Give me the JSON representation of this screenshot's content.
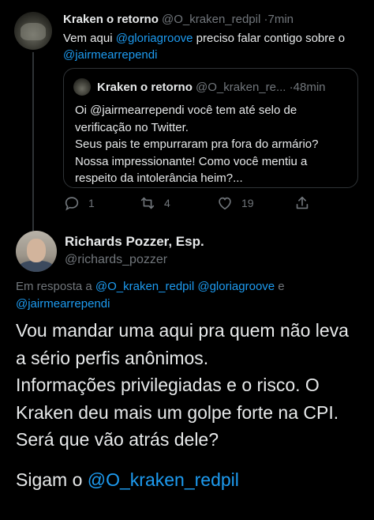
{
  "tweet1": {
    "author_name": "Kraken o retorno",
    "author_handle": "@O_kraken_redpil",
    "separator": "·",
    "time": "7min",
    "text_a": "Vem aqui ",
    "mention_a": "@gloriagroove",
    "text_b": " preciso falar contigo sobre o ",
    "mention_b": "@jairmearrependi",
    "quote": {
      "author_name": "Kraken o retorno",
      "author_handle": "@O_kraken_re...",
      "separator": "·",
      "time": "48min",
      "lines": [
        "Oi @jairmearrependi você tem até selo de",
        "verificação no Twitter.",
        "Seus pais te empurraram pra fora do armário?",
        "Nossa impressionante! Como você mentiu a",
        "respeito da intolerância heim?..."
      ]
    },
    "actions": {
      "replies": "1",
      "retweets": "4",
      "likes": "19"
    }
  },
  "tweet2": {
    "author_name": "Richards Pozzer, Esp.",
    "author_handle": "@richards_pozzer",
    "reply_prefix": "Em resposta a ",
    "reply_mention_1": "@O_kraken_redpil",
    "reply_mention_2": "@gloriagroove",
    "reply_conj": " e ",
    "reply_mention_3": "@jairmearrependi",
    "paragraph_1": "Vou mandar uma aqui pra quem não leva a sério perfis anônimos.",
    "paragraph_2": "Informações privilegiadas e o risco. O Kraken deu mais um golpe forte na CPI.",
    "paragraph_3": "Será que vão atrás dele?",
    "paragraph_4_prefix": "Sigam o ",
    "paragraph_4_mention": "@O_kraken_redpil"
  },
  "colors": {
    "background": "#000000",
    "text": "#e7e9ea",
    "muted": "#71767b",
    "link": "#1d9bf0",
    "border": "#2f3336"
  },
  "icons": [
    "reply-icon",
    "retweet-icon",
    "like-icon",
    "share-icon"
  ]
}
